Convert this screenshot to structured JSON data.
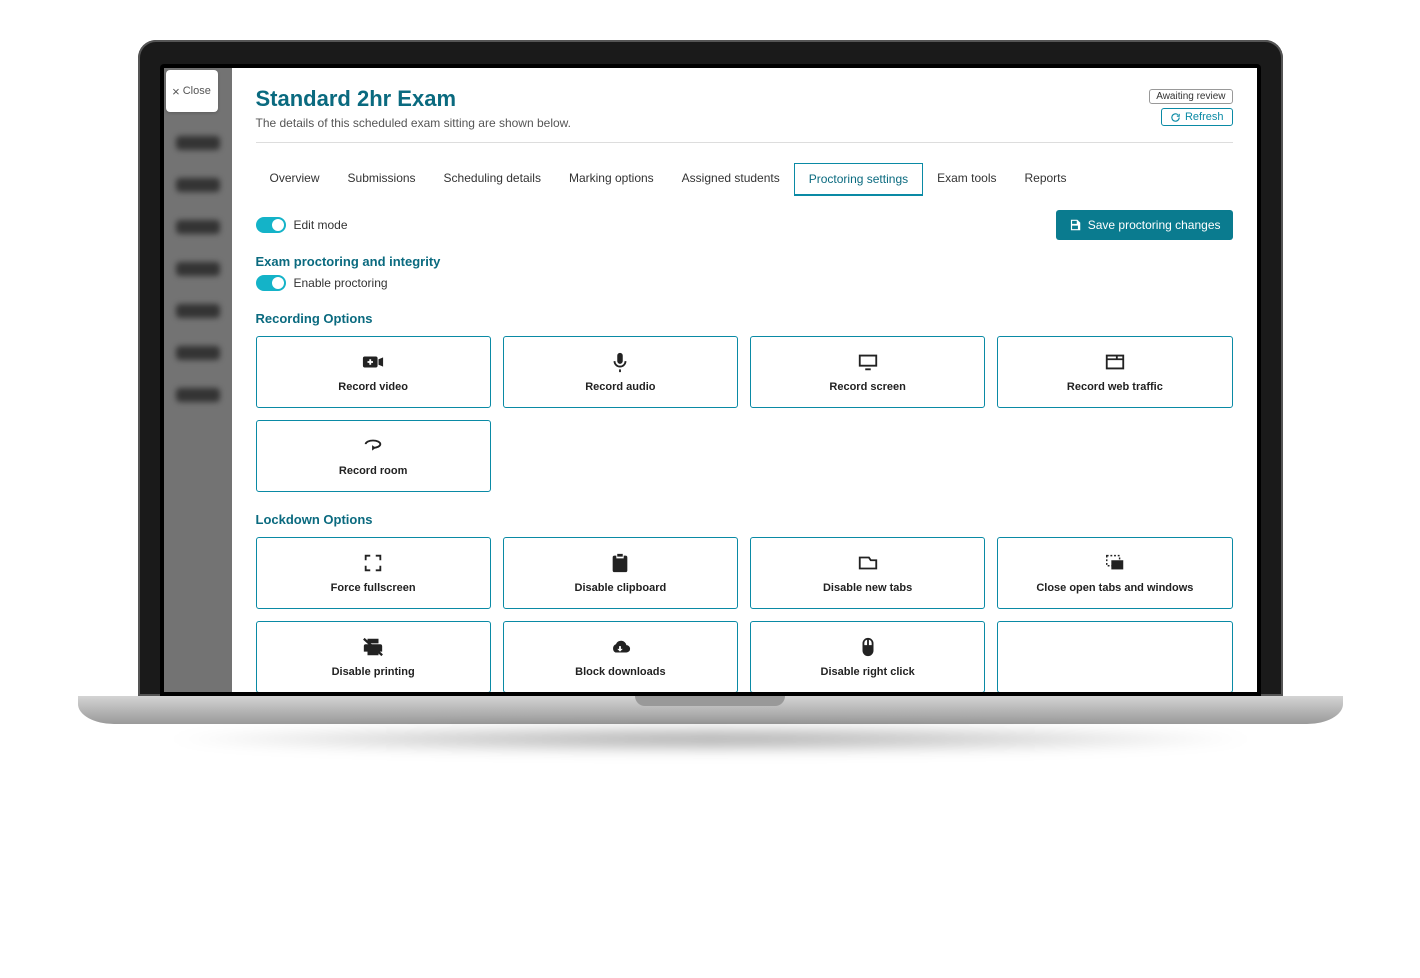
{
  "close_label": "Close",
  "header": {
    "title": "Standard 2hr Exam",
    "subtitle": "The details of this scheduled exam sitting are shown below.",
    "status": "Awaiting review",
    "refresh": "Refresh"
  },
  "tabs": [
    {
      "label": "Overview",
      "active": false
    },
    {
      "label": "Submissions",
      "active": false
    },
    {
      "label": "Scheduling details",
      "active": false
    },
    {
      "label": "Marking options",
      "active": false
    },
    {
      "label": "Assigned students",
      "active": false
    },
    {
      "label": "Proctoring settings",
      "active": true
    },
    {
      "label": "Exam tools",
      "active": false
    },
    {
      "label": "Reports",
      "active": false
    }
  ],
  "edit_mode_label": "Edit mode",
  "save_button": "Save proctoring changes",
  "integrity_heading": "Exam proctoring and integrity",
  "enable_proctoring_label": "Enable proctoring",
  "recording_heading": "Recording Options",
  "recording_options": [
    {
      "id": "record-video",
      "label": "Record video",
      "icon": "video-plus"
    },
    {
      "id": "record-audio",
      "label": "Record audio",
      "icon": "mic"
    },
    {
      "id": "record-screen",
      "label": "Record screen",
      "icon": "monitor"
    },
    {
      "id": "record-web-traffic",
      "label": "Record web traffic",
      "icon": "browser"
    },
    {
      "id": "record-room",
      "label": "Record room",
      "icon": "rotate-360"
    }
  ],
  "lockdown_heading": "Lockdown Options",
  "lockdown_options": [
    {
      "id": "force-fullscreen",
      "label": "Force fullscreen",
      "icon": "fullscreen"
    },
    {
      "id": "disable-clipboard",
      "label": "Disable clipboard",
      "icon": "clipboard"
    },
    {
      "id": "disable-new-tabs",
      "label": "Disable new tabs",
      "icon": "tab"
    },
    {
      "id": "close-open-tabs",
      "label": "Close open tabs and windows",
      "icon": "close-windows"
    },
    {
      "id": "disable-printing",
      "label": "Disable printing",
      "icon": "no-print"
    },
    {
      "id": "block-downloads",
      "label": "Block downloads",
      "icon": "cloud-down"
    },
    {
      "id": "disable-right-click",
      "label": "Disable right click",
      "icon": "mouse"
    },
    {
      "id": "empty",
      "label": "",
      "icon": ""
    }
  ]
}
